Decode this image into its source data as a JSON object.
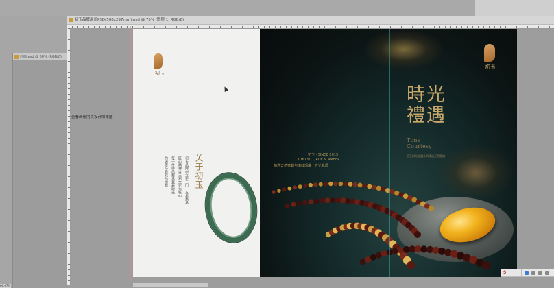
{
  "main_window": {
    "title": "初玉品牌画册PSD(508x297mm).psd @ 75% (图层 1, RGB/8)"
  },
  "bg_window": {
    "title": "封面.psd @ 50% (RGB/8)"
  },
  "side_label": "查看画册内页设计效果图",
  "status": {
    "zoom": "66.67%"
  },
  "left_page": {
    "logo_char": "初玉",
    "heading": "关于初玉",
    "body_col1": "初玉品牌创立于二〇一五年秉承",
    "body_col2": "匠心精神以玉石文化为核心",
    "body_col3": "每一件作品都承载着时光",
    "body_col4": "的温度与自然的馈赠"
  },
  "right_page": {
    "logo_char": "初玉",
    "title_line1": "時光",
    "title_line2": "禮遇",
    "title_en_line1": "Time",
    "title_en_line2": "Courtesy",
    "small_caption": "初玉时光礼遇系列精选天然蜜蜡",
    "mid_line1": "初玉 · SINCE 2015",
    "mid_line2": "CHU YU · JADE & AMBER",
    "mid_line3": "精选天然蜜蜡与南红玛瑙 · 时光礼遇"
  },
  "tray": {
    "ime_label": "S"
  },
  "colors": {
    "gold": "#c9a86c",
    "amber": "#f2b31e",
    "jade": "#3d6b52",
    "guide": "#3aa4a8"
  }
}
